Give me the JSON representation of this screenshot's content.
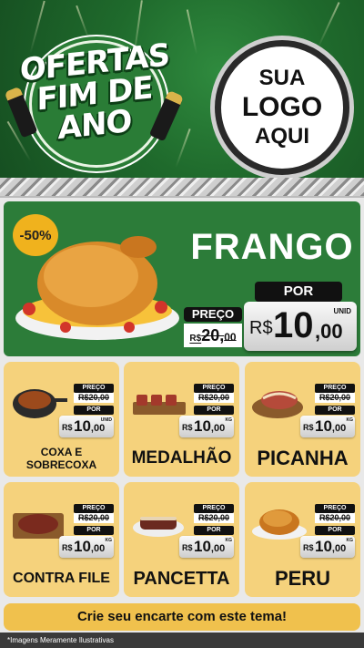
{
  "header": {
    "badge_lines": [
      "OFERTAS",
      "FIM DE",
      "ANO"
    ],
    "logo_lines": [
      "SUA",
      "LOGO",
      "AQUI"
    ]
  },
  "hero": {
    "discount": "-50%",
    "product": "FRANGO",
    "preco_label": "PREÇO",
    "old_price_currency": "R$",
    "old_price": "20,",
    "old_price_cents": "00",
    "por_label": "POR",
    "currency": "R$",
    "price": "10",
    "price_cents": ",00",
    "unit": "UNID"
  },
  "cards": [
    {
      "name": "COXA E SOBRECOXA",
      "preco_label": "PREÇO",
      "old_price": "R$20,00",
      "por_label": "POR",
      "currency": "R$",
      "price": "10",
      "cents": ",00",
      "unit": "UNID"
    },
    {
      "name": "MEDALHÃO",
      "preco_label": "PREÇO",
      "old_price": "R$20,00",
      "por_label": "POR",
      "currency": "R$",
      "price": "10",
      "cents": ",00",
      "unit": "KG"
    },
    {
      "name": "PICANHA",
      "preco_label": "PREÇO",
      "old_price": "R$20,00",
      "por_label": "POR",
      "currency": "R$",
      "price": "10",
      "cents": ",00",
      "unit": "KG"
    },
    {
      "name": "CONTRA FILE",
      "preco_label": "PREÇO",
      "old_price": "R$20,00",
      "por_label": "POR",
      "currency": "R$",
      "price": "10",
      "cents": ",00",
      "unit": "KG"
    },
    {
      "name": "PANCETTA",
      "preco_label": "PREÇO",
      "old_price": "R$20,00",
      "por_label": "POR",
      "currency": "R$",
      "price": "10",
      "cents": ",00",
      "unit": "KG"
    },
    {
      "name": "PERU",
      "preco_label": "PREÇO",
      "old_price": "R$20,00",
      "por_label": "POR",
      "currency": "R$",
      "price": "10",
      "cents": ",00",
      "unit": "KG"
    }
  ],
  "cta": "Crie seu encarte com este tema!",
  "footer": "*Imagens Meramente Ilustrativas",
  "colors": {
    "green": "#2c7c39",
    "card": "#f5d27c",
    "gold": "#f0b21d",
    "black": "#111111"
  }
}
